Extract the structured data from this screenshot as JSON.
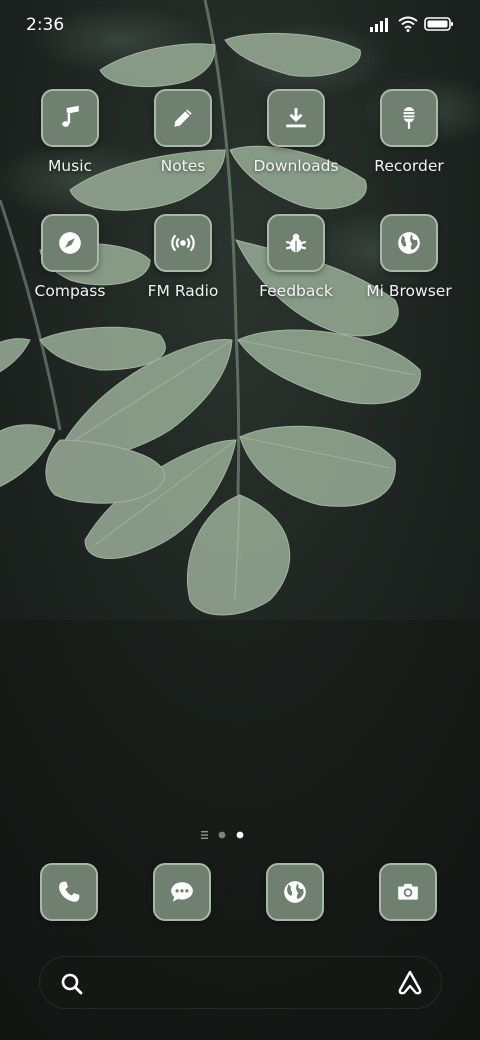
{
  "status_bar": {
    "time": "2:36",
    "icons": [
      "signal-icon",
      "wifi-icon",
      "battery-icon"
    ]
  },
  "home_grid": [
    {
      "label": "Music",
      "icon": "music-note-icon"
    },
    {
      "label": "Notes",
      "icon": "pencil-icon"
    },
    {
      "label": "Downloads",
      "icon": "download-icon"
    },
    {
      "label": "Recorder",
      "icon": "microphone-icon"
    },
    {
      "label": "Compass",
      "icon": "compass-icon"
    },
    {
      "label": "FM Radio",
      "icon": "radio-icon"
    },
    {
      "label": "Feedback",
      "icon": "bug-icon"
    },
    {
      "label": "Mi Browser",
      "icon": "globe-icon"
    }
  ],
  "page_indicator": {
    "pages": 3,
    "current": 3,
    "first_is_list": true
  },
  "dock": [
    {
      "icon": "phone-icon"
    },
    {
      "icon": "message-icon"
    },
    {
      "icon": "globe-icon"
    },
    {
      "icon": "camera-icon"
    }
  ],
  "search_bar": {
    "left_icon": "search-icon",
    "right_icon": "assistant-icon"
  },
  "colors": {
    "tile": "#6f8070",
    "tile_border": "#aab8aa",
    "leaf": "#8ea38d",
    "background": "#161b18"
  }
}
